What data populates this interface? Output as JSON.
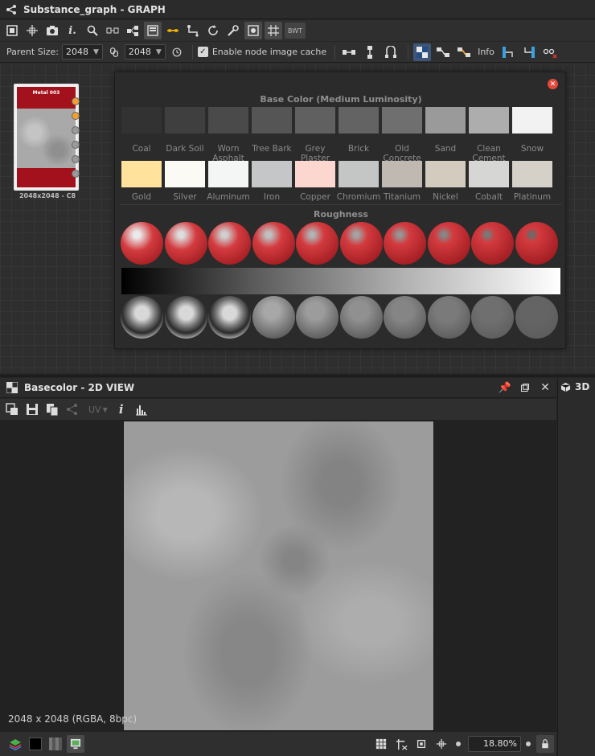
{
  "graph_panel": {
    "title": "Substance_graph - GRAPH",
    "bwt_label": "BWT",
    "parent_size_label": "Parent Size:",
    "width_value": "2048",
    "height_value": "2048",
    "cache_label": "Enable node image cache",
    "cache_checked": true,
    "info_label": "Info"
  },
  "node": {
    "title": "Metal 003",
    "size_label": "2048x2048 - C8",
    "band_color": "#a2111c"
  },
  "popup": {
    "base_color_title": "Base Color (Medium Luminosity)",
    "row1": [
      {
        "label": "Coal",
        "color": "#323232"
      },
      {
        "label": "Dark Soil",
        "color": "#3f3f3f"
      },
      {
        "label": "Worn Asphalt",
        "color": "#4a4a4a"
      },
      {
        "label": "Tree Bark",
        "color": "#555555"
      },
      {
        "label": "Grey Plaster",
        "color": "#606060"
      },
      {
        "label": "Brick",
        "color": "#636363"
      },
      {
        "label": "Old Concrete",
        "color": "#6f6f6f"
      },
      {
        "label": "Sand",
        "color": "#9a9a9a"
      },
      {
        "label": "Clean Cement",
        "color": "#adadad"
      },
      {
        "label": "Snow",
        "color": "#f2f2f2"
      }
    ],
    "row2": [
      {
        "label": "Gold",
        "color": "#ffe29b"
      },
      {
        "label": "Silver",
        "color": "#fcfaf5"
      },
      {
        "label": "Aluminum",
        "color": "#f4f5f5"
      },
      {
        "label": "Iron",
        "color": "#c5c6c7"
      },
      {
        "label": "Copper",
        "color": "#fbd7cf"
      },
      {
        "label": "Chromium",
        "color": "#c4c5c5"
      },
      {
        "label": "Titanium",
        "color": "#c0b9b1"
      },
      {
        "label": "Nickel",
        "color": "#d3cbbe"
      },
      {
        "label": "Cobalt",
        "color": "#d6d6d4"
      },
      {
        "label": "Platinum",
        "color": "#d5d0c8"
      }
    ],
    "roughness_title": "Roughness",
    "sphere_count": 10
  },
  "view2d": {
    "title": "Basecolor - 2D VIEW",
    "uv_label": "UV",
    "texture_info": "2048 x 2048 (RGBA, 8bpc)",
    "zoom": "18.80%"
  },
  "right_panel": {
    "title": "3D"
  }
}
